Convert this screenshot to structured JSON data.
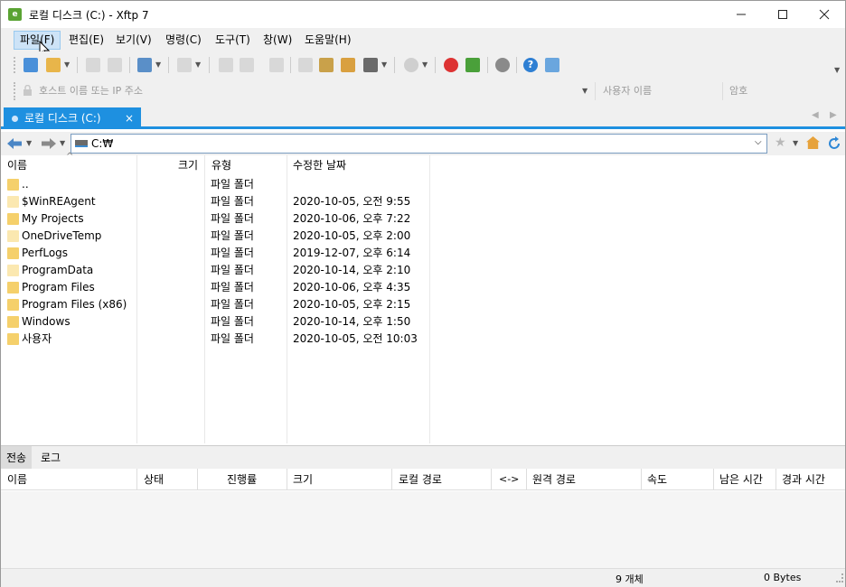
{
  "window": {
    "title": "로컬 디스크 (C:) - Xftp 7",
    "app_icon_letter": "e"
  },
  "menu": {
    "items": [
      "파일(F)",
      "편집(E)",
      "보기(V)",
      "명령(C)",
      "도구(T)",
      "창(W)",
      "도움말(H)"
    ]
  },
  "address": {
    "host_placeholder": "호스트 이름 또는 IP 주소",
    "user_placeholder": "사용자 이름",
    "password_placeholder": "암호"
  },
  "tab": {
    "label": "로컬 디스크 (C:)",
    "close": "×"
  },
  "path": {
    "value": "C:₩"
  },
  "columns": {
    "name": "이름",
    "size": "크기",
    "type": "유형",
    "modified": "수정한 날짜"
  },
  "files": [
    {
      "name": "..",
      "type": "파일 폴더",
      "modified": ""
    },
    {
      "name": "$WinREAgent",
      "type": "파일 폴더",
      "modified": "2020-10-05, 오전 9:55"
    },
    {
      "name": "My Projects",
      "type": "파일 폴더",
      "modified": "2020-10-06, 오후 7:22"
    },
    {
      "name": "OneDriveTemp",
      "type": "파일 폴더",
      "modified": "2020-10-05, 오후 2:00"
    },
    {
      "name": "PerfLogs",
      "type": "파일 폴더",
      "modified": "2019-12-07, 오후 6:14"
    },
    {
      "name": "ProgramData",
      "type": "파일 폴더",
      "modified": "2020-10-14, 오후 2:10"
    },
    {
      "name": "Program Files",
      "type": "파일 폴더",
      "modified": "2020-10-06, 오후 4:35"
    },
    {
      "name": "Program Files (x86)",
      "type": "파일 폴더",
      "modified": "2020-10-05, 오후 2:15"
    },
    {
      "name": "Windows",
      "type": "파일 폴더",
      "modified": "2020-10-14, 오후 1:50"
    },
    {
      "name": "사용자",
      "type": "파일 폴더",
      "modified": "2020-10-05, 오전 10:03"
    }
  ],
  "bottom_tabs": {
    "transfer": "전송",
    "log": "로그"
  },
  "transfer_columns": [
    "이름",
    "상태",
    "진행률",
    "크기",
    "로컬 경로",
    "<->",
    "원격 경로",
    "속도",
    "남은 시간",
    "경과 시간"
  ],
  "status": {
    "count": "9 개체",
    "size": "0 Bytes"
  },
  "colors": {
    "accent": "#1e90e0",
    "folder": "#f5d06b"
  }
}
